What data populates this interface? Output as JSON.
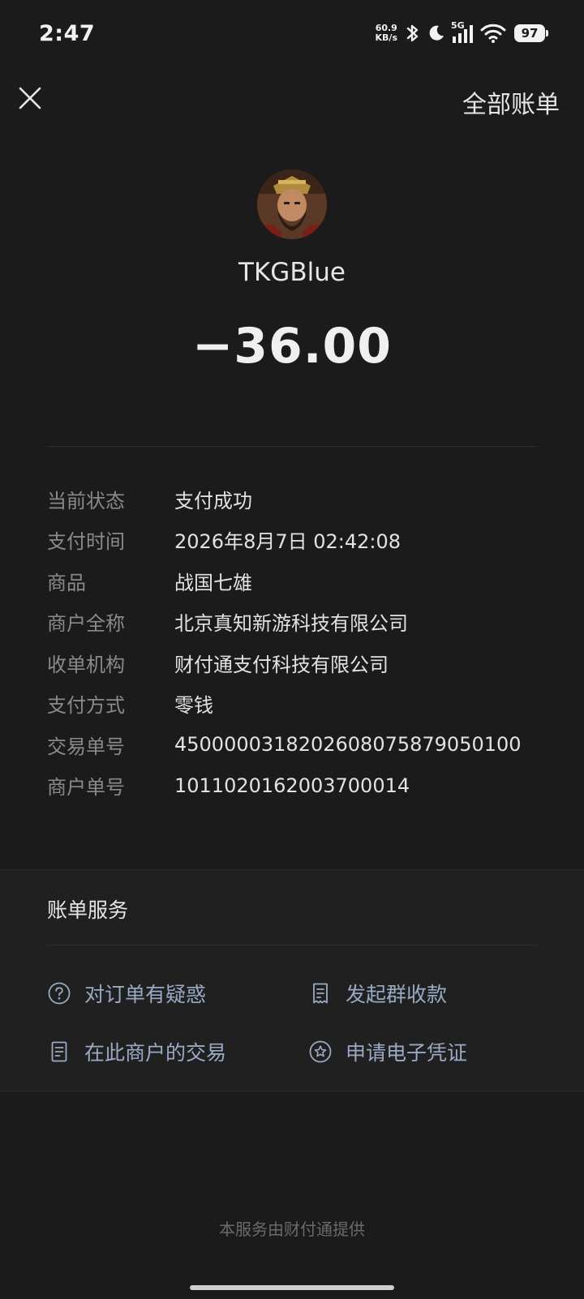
{
  "status_bar": {
    "time": "2:47",
    "net_speed_value": "60.9",
    "net_speed_unit": "KB/s",
    "network": "5G",
    "battery": "97"
  },
  "header": {
    "all_bills_label": "全部账单"
  },
  "payee": {
    "name": "TKGBlue",
    "amount": "−36.00"
  },
  "details": [
    {
      "label": "当前状态",
      "value": "支付成功"
    },
    {
      "label": "支付时间",
      "value": "2026年8月7日 02:42:08"
    },
    {
      "label": "商品",
      "value": "战国七雄"
    },
    {
      "label": "商户全称",
      "value": "北京真知新游科技有限公司"
    },
    {
      "label": "收单机构",
      "value": "财付通支付科技有限公司"
    },
    {
      "label": "支付方式",
      "value": "零钱"
    },
    {
      "label": "交易单号",
      "value": "4500000318202608075879050100"
    },
    {
      "label": "商户单号",
      "value": "1011020162003700014"
    }
  ],
  "services": {
    "title": "账单服务",
    "items": [
      {
        "label": "对订单有疑惑",
        "icon": "question-circle-icon"
      },
      {
        "label": "发起群收款",
        "icon": "receipt-icon"
      },
      {
        "label": "在此商户的交易",
        "icon": "document-icon"
      },
      {
        "label": "申请电子凭证",
        "icon": "star-badge-icon"
      }
    ],
    "link_color": "#9aa9c4"
  },
  "footer": {
    "text": "本服务由财付通提供"
  }
}
